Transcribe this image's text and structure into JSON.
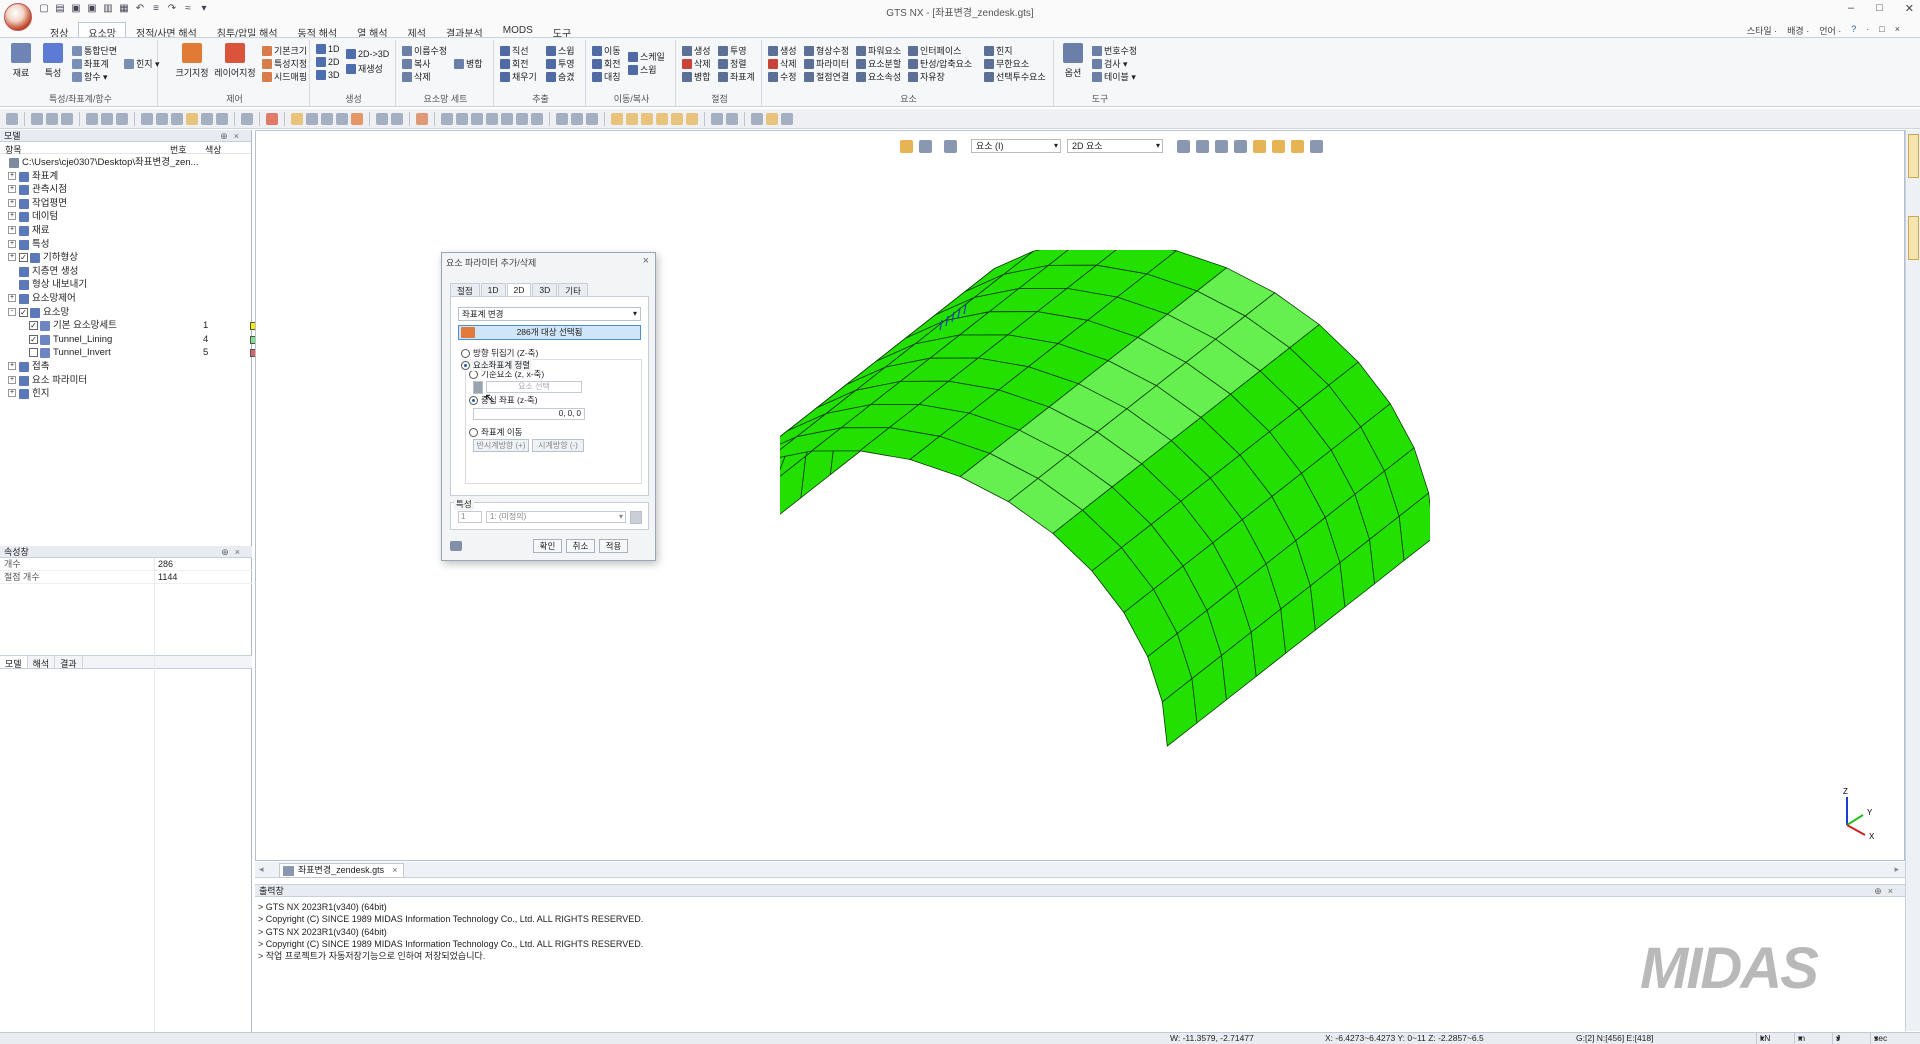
{
  "window": {
    "title": "GTS NX - [좌표변경_zendesk.gts]",
    "controls": [
      "–",
      "□",
      "✕"
    ],
    "quick_access": [
      "□",
      "⌂",
      "▣",
      "▣",
      "▤",
      "▥",
      "↶",
      "↷",
      "=",
      "≈"
    ]
  },
  "menu": {
    "tabs": [
      "정상",
      "요소망",
      "정적/사면 해석",
      "침투/압밀 해석",
      "동적 해석",
      "열 해석",
      "제석",
      "결과분석",
      "MODS",
      "도구"
    ],
    "active_index": 1,
    "right": [
      "스타일 ·",
      "배경 ·",
      "언어 ·",
      "?",
      "·",
      "□",
      "×"
    ]
  },
  "ribbon": {
    "groups": [
      {
        "label": "특성/좌표계/함수",
        "big": [
          "재료",
          "특성"
        ],
        "small": [
          "통합단면",
          "좌표계",
          "함수 ▾",
          "힌지 ▾"
        ]
      },
      {
        "label": "제어",
        "big": [
          "크기지정",
          "레이어지정"
        ],
        "small": [
          "기본크기",
          "특성지정",
          "시드매핑"
        ]
      },
      {
        "label": "생성",
        "small": [
          "1D",
          "2D",
          "3D",
          "2D->3D",
          "재생성"
        ]
      },
      {
        "label": "요소망 세트",
        "small": [
          "이름수정",
          "복사",
          "삭제",
          "병합"
        ]
      },
      {
        "label": "추출",
        "small": [
          "직선",
          "회전",
          "채우기",
          "스윕",
          "투영",
          "숨겼"
        ]
      },
      {
        "label": "이동/복사",
        "small": [
          "이동",
          "회전",
          "대칭",
          "스케일",
          "스윕"
        ]
      },
      {
        "label": "절점",
        "small": [
          "생성",
          "삭제",
          "병합",
          "투영",
          "정렬",
          "좌표계"
        ]
      },
      {
        "label": "요소",
        "small": [
          "생성",
          "삭제",
          "수정",
          "형상수정",
          "파라미터",
          "절점연결",
          "파워요소",
          "요소분할",
          "요소속성",
          "인터페이스",
          "탄성/압축요소",
          "자유장",
          "힌지",
          "무한요소",
          "선택투수요소"
        ]
      },
      {
        "label": "도구",
        "big": [
          "옵션"
        ],
        "small": [
          "번호수정",
          "검사 ▾",
          "테이블 ▾"
        ]
      }
    ]
  },
  "model_panel": {
    "title": "모델",
    "col_item": "항목",
    "col_number": "번호",
    "col_color": "색상",
    "tree": [
      {
        "label": "C:\\Users\\cje0307\\Desktop\\좌표변경_zen...",
        "level": 0,
        "expander": "",
        "check": "",
        "number": "",
        "color": ""
      },
      {
        "label": "좌표계",
        "level": 1,
        "expander": "+",
        "check": "",
        "number": "",
        "color": ""
      },
      {
        "label": "관측시점",
        "level": 1,
        "expander": "+",
        "check": "",
        "number": "",
        "color": ""
      },
      {
        "label": "작업평면",
        "level": 1,
        "expander": "+",
        "check": "",
        "number": "",
        "color": ""
      },
      {
        "label": "데이텀",
        "level": 1,
        "expander": "+",
        "check": "",
        "number": "",
        "color": ""
      },
      {
        "label": "재료",
        "level": 1,
        "expander": "+",
        "check": "",
        "number": "",
        "color": ""
      },
      {
        "label": "특성",
        "level": 1,
        "expander": "+",
        "check": "",
        "number": "",
        "color": ""
      },
      {
        "label": "기하형상",
        "level": 1,
        "expander": "+",
        "check": "✓",
        "number": "",
        "color": ""
      },
      {
        "label": "지층면 생성",
        "level": 1,
        "expander": "",
        "check": "",
        "number": "",
        "color": ""
      },
      {
        "label": "형상 내보내기",
        "level": 1,
        "expander": "",
        "check": "",
        "number": "",
        "color": ""
      },
      {
        "label": "요소망제어",
        "level": 1,
        "expander": "+",
        "check": "",
        "number": "",
        "color": ""
      },
      {
        "label": "요소망",
        "level": 1,
        "expander": "-",
        "check": "✓",
        "number": "",
        "color": ""
      },
      {
        "label": "기본 요소망세트",
        "level": 2,
        "expander": "",
        "check": "✓",
        "number": "1",
        "color": "#f2ee00"
      },
      {
        "label": "Tunnel_Lining",
        "level": 2,
        "expander": "",
        "check": "✓",
        "number": "4",
        "color": "#7fe08c"
      },
      {
        "label": "Tunnel_Invert",
        "level": 2,
        "expander": "",
        "check": "",
        "number": "5",
        "color": "#d9636b"
      },
      {
        "label": "접촉",
        "level": 1,
        "expander": "+",
        "check": "",
        "number": "",
        "color": ""
      },
      {
        "label": "요소 파라미터",
        "level": 1,
        "expander": "+",
        "check": "",
        "number": "",
        "color": ""
      },
      {
        "label": "힌지",
        "level": 1,
        "expander": "+",
        "check": "",
        "number": "",
        "color": ""
      }
    ],
    "bottom_tabs": [
      "모델",
      "해석",
      "결과"
    ]
  },
  "property_panel": {
    "title": "속성창",
    "rows": [
      {
        "key": "개수",
        "value": "286"
      },
      {
        "key": "절점 개수",
        "value": "1144"
      }
    ]
  },
  "viewport_toolbar": {
    "filter_label": "요소 (I)",
    "type_label": "2D 요소"
  },
  "dialog": {
    "title": "요소 파라미터 추가/삭제",
    "tabs": [
      "절점",
      "1D",
      "2D",
      "3D",
      "기타"
    ],
    "active_tab": 2,
    "mode": "좌표계 변경",
    "select_button": "286개 대상 선택됨",
    "opt_flip": "방향 뒤집기 (Z-축)",
    "opt_align": "요소좌표계 정렬",
    "opt_ref_elem": "기준요소 (z, x-축)",
    "ref_elem_placeholder": "요소 선택",
    "opt_center": "중심 좌표 (z-축)",
    "center_value": "0, 0, 0",
    "opt_move": "좌표계 이동",
    "btn_ccw": "반시계방향 (+)",
    "btn_cw": "시계방향 (-)",
    "prop_label": "특성",
    "prop_number": "1",
    "prop_value": "1: (미정의)",
    "btn_ok": "확인",
    "btn_cancel": "취소",
    "btn_apply": "적용"
  },
  "document_tab": {
    "label": "좌표변경_zendesk.gts",
    "close": "×"
  },
  "output": {
    "title": "출력창",
    "lines": [
      "> GTS NX 2023R1(v340) (64bit)",
      "> Copyright (C) SINCE 1989 MIDAS Information Technology Co., Ltd. ALL RIGHTS RESERVED.",
      "> GTS NX 2023R1(v340) (64bit)",
      "> Copyright (C) SINCE 1989 MIDAS Information Technology Co., Ltd. ALL RIGHTS RESERVED.",
      "> 작업 프로젝트가 자동저장기능으로 인하여 저장되었습니다."
    ]
  },
  "brand": {
    "logo": "MIDAS"
  },
  "axis": {
    "z": "Z",
    "y": "Y",
    "x": "X"
  },
  "status_bar": {
    "w": "W: -11.3579, -2.71477",
    "xyz": "X: -6.4273~6.4273 Y: 0~11 Z: -2.2857~6.5",
    "counts": "G:[2] N:[456] E:[418]",
    "unit_force": "kN",
    "unit_length": "m",
    "unit_energy": "J",
    "unit_time": "sec"
  },
  "colors": {
    "mesh_fill": "#22e000",
    "mesh_highlight": "#66f050",
    "dialog_select": "#cfe5f8",
    "accent": "#4a8fd0"
  }
}
